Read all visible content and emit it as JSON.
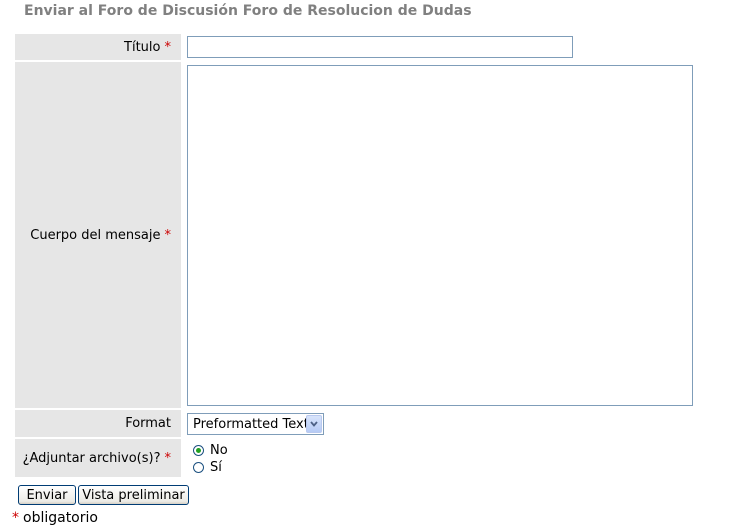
{
  "page_title": "Enviar al Foro de Discusión Foro de Resolucion de Dudas",
  "form": {
    "required_marker": "*",
    "title_field": {
      "label": "Título",
      "value": ""
    },
    "body_field": {
      "label": "Cuerpo del mensaje",
      "value": ""
    },
    "format_field": {
      "label": "Format",
      "selected": "Preformatted Text"
    },
    "attach_field": {
      "label": "¿Adjuntar archivo(s)?",
      "options": [
        {
          "label": "No",
          "checked": true
        },
        {
          "label": "Sí",
          "checked": false
        }
      ]
    },
    "buttons": {
      "submit_label": "Enviar",
      "preview_label": "Vista preliminar"
    }
  },
  "footnote": {
    "marker": "*",
    "text": "obligatorio"
  },
  "colors": {
    "title": "#808080",
    "label_bg": "#e6e6e6",
    "required": "#cc0000",
    "input_border": "#7f9db9",
    "radio_dot": "#21a121"
  },
  "icons": {
    "select_arrow": "chevron-down-icon"
  }
}
